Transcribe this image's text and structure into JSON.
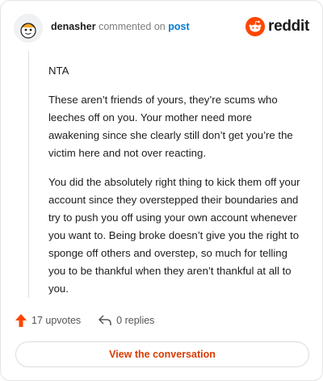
{
  "header": {
    "username": "denasher",
    "verb": "commented on",
    "post_link": "post",
    "brand": "reddit"
  },
  "comment": {
    "paragraphs": [
      "NTA",
      "These aren’t friends of yours, they’re scums who leeches off on you. Your mother need more awakening since she clearly still don’t get you’re the victim here and not over reacting.",
      "You did the absolutely right thing to kick them off your account since they overstepped their boundaries and try to push you off using your own account whenever you want to. Being broke doesn’t give you the right to sponge off others and overstep, so much for telling you to be thankful when they aren’t thankful at all to you."
    ]
  },
  "actions": {
    "upvotes": "17 upvotes",
    "replies": "0 replies"
  },
  "cta": {
    "label": "View the conversation"
  },
  "colors": {
    "accent": "#d93a00",
    "upvote": "#ff4500",
    "link": "#0079d3"
  }
}
